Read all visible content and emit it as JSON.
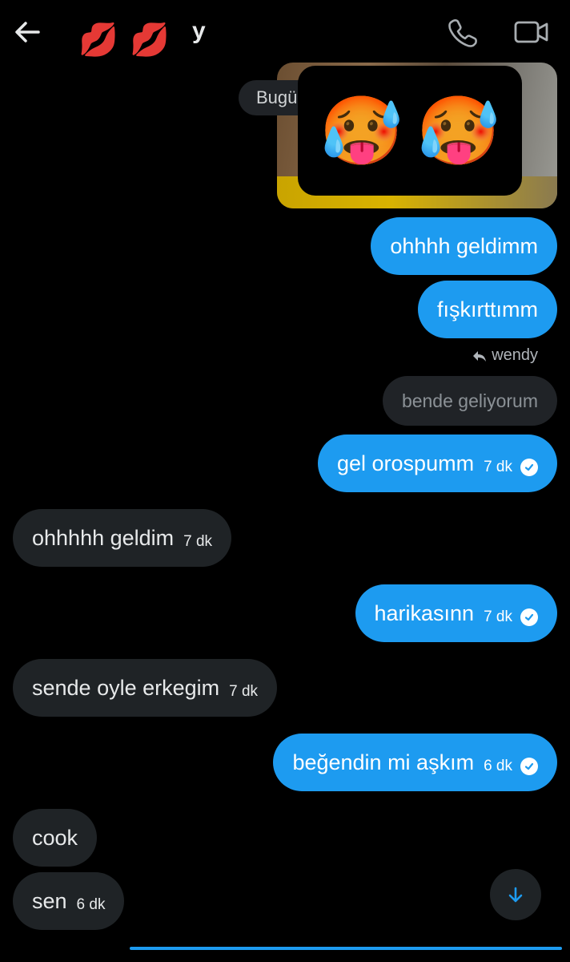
{
  "header": {
    "title_emoji": [
      "💋",
      "💋"
    ],
    "title_fragment": "y",
    "back_icon": "arrow-left-icon",
    "call_icon": "phone-icon",
    "video_icon": "video-camera-icon"
  },
  "photo_message": {
    "day_label": "Bugü",
    "sticker_emoji": [
      "🥵",
      "🥵"
    ]
  },
  "messages": [
    {
      "side": "sent",
      "text": "ohhhh geldimm"
    },
    {
      "side": "sent",
      "text": "fışkırttımm"
    },
    {
      "reply_to": "wendy",
      "quoted_text": "bende geliyorum"
    },
    {
      "side": "sent",
      "text": "gel orospumm",
      "time": "7 dk"
    },
    {
      "side": "received",
      "text": "ohhhhh geldim",
      "time": "7 dk"
    },
    {
      "side": "sent",
      "text": "harikasınn",
      "time": "7 dk"
    },
    {
      "side": "received",
      "text": "sende oyle erkegim",
      "time": "7 dk"
    },
    {
      "side": "sent",
      "text": "beğendin mi aşkım",
      "time": "6 dk"
    },
    {
      "side": "received",
      "text": "cook"
    },
    {
      "side": "received",
      "text": "sen",
      "time": "6 dk"
    }
  ],
  "colors": {
    "accent": "#1d9bf0",
    "received_bubble": "#1f2326",
    "background": "#000000"
  },
  "scroll_button_icon": "arrow-down-icon"
}
